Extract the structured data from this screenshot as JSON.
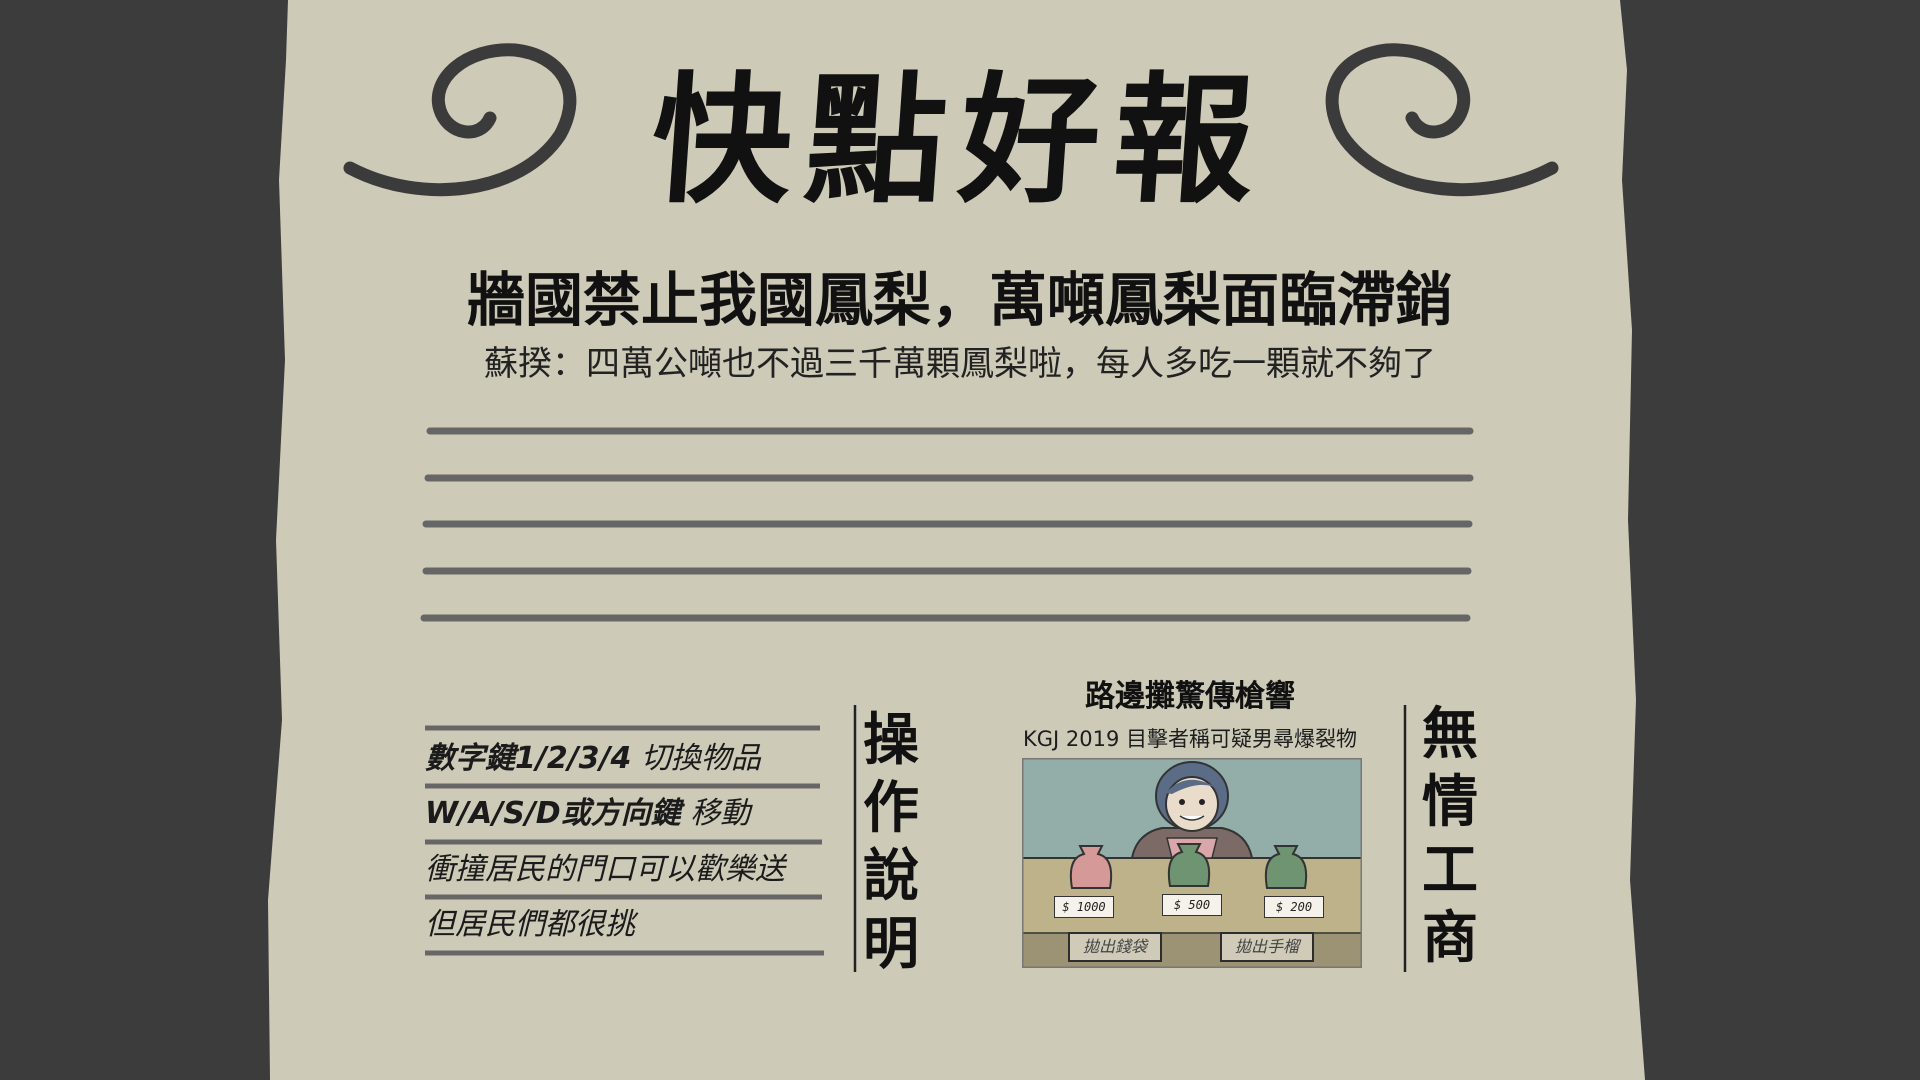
{
  "newspaper": {
    "masthead": "快點好報",
    "headline": "牆國禁止我國鳳梨，萬噸鳳梨面臨滯銷",
    "subheadline": "蘇揆：四萬公噸也不過三千萬顆鳳梨啦，每人多吃一顆就不夠了"
  },
  "instructions": {
    "title": "操作說明",
    "lines": [
      {
        "key": "數字鍵1/2/3/4",
        "action": " 切換物品"
      },
      {
        "key": "W/A/S/D或方向鍵",
        "action": " 移動"
      },
      {
        "key": "",
        "action": "衝撞居民的門口可以歡樂送"
      },
      {
        "key": "",
        "action": "但居民們都很挑"
      }
    ]
  },
  "ad": {
    "title": "路邊攤驚傳槍響",
    "subtitle": "KGJ 2019 目擊者稱可疑男尋爆裂物",
    "prices": [
      "$ 1000",
      "$ 500",
      "$ 200"
    ],
    "buttons": [
      "拋出錢袋",
      "拋出手榴"
    ]
  },
  "sidebar_right": {
    "title": "無情工商"
  },
  "colors": {
    "paper": "#cdcab8",
    "background": "#3c3c3c",
    "rule_line": "#666666",
    "ink": "#111111"
  }
}
